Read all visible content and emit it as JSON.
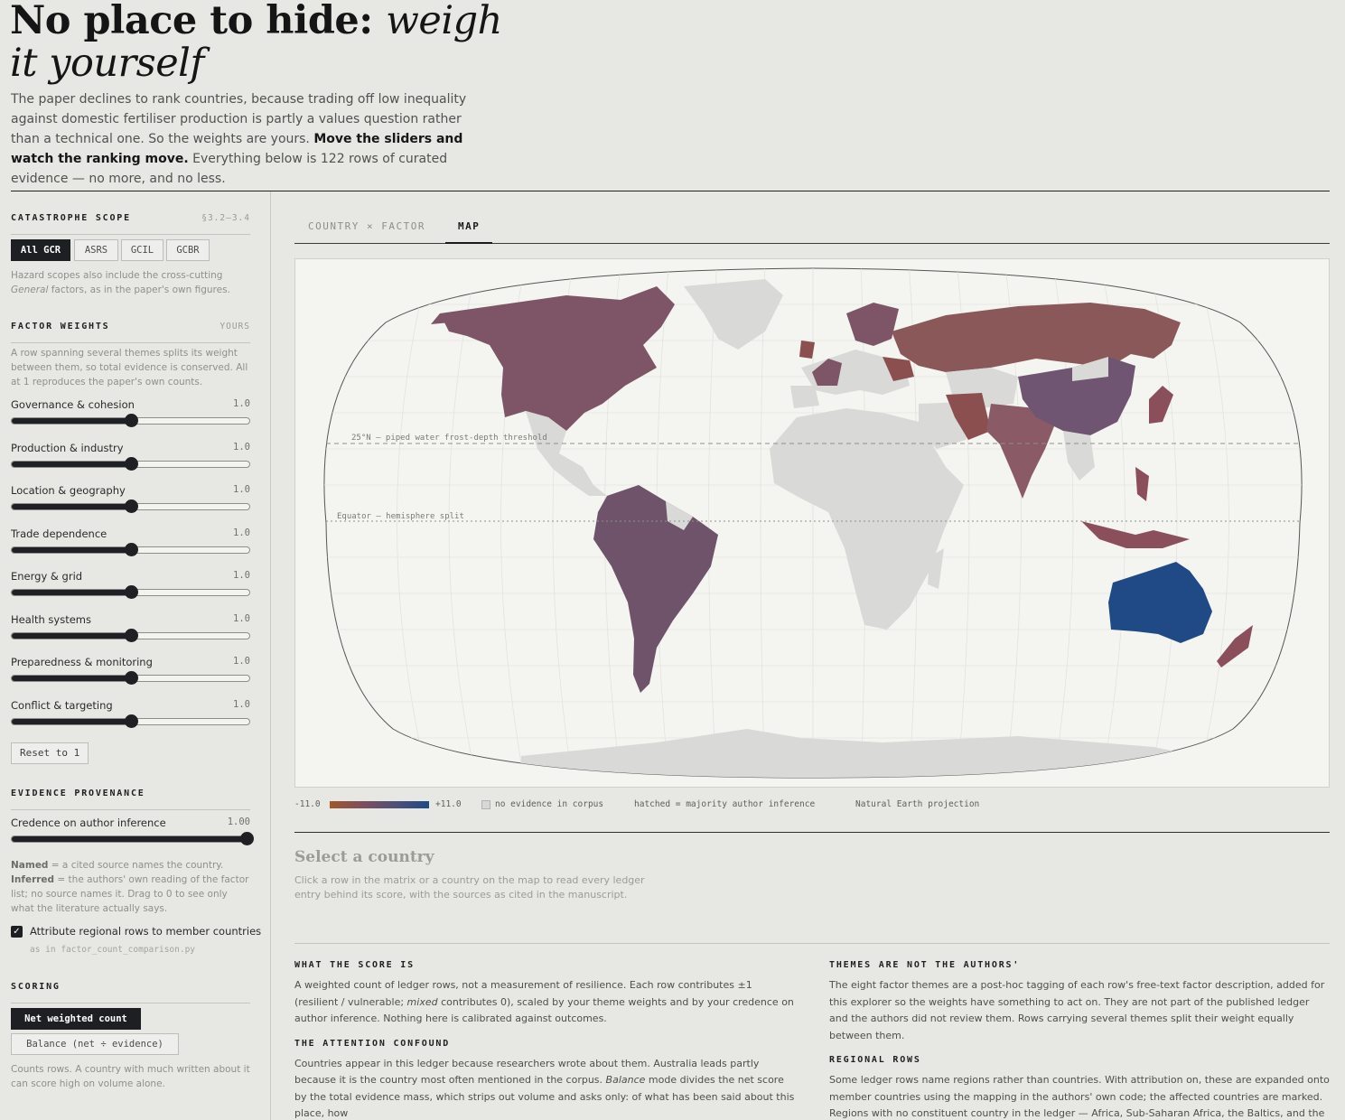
{
  "header": {
    "title_bold": "No place to hide:",
    "title_italic": "weigh it yourself",
    "intro_1": "The paper declines to rank countries, because trading off low inequality against domestic fertiliser production is partly a values question rather than a technical one. So the weights are yours.",
    "intro_bold": "Move the sliders and watch the ranking move.",
    "intro_2": "Everything below is 122 rows of curated evidence — no more, and no less."
  },
  "scope": {
    "label": "CATASTROPHE SCOPE",
    "ref": "§3.2–3.4",
    "options": [
      "All GCR",
      "ASRS",
      "GCIL",
      "GCBR"
    ],
    "selected": "All GCR",
    "note_1": "Hazard scopes also include the cross-cutting",
    "note_italic": "General",
    "note_2": "factors, as in the paper's own figures."
  },
  "weights": {
    "label": "FACTOR WEIGHTS",
    "ref": "YOURS",
    "note": "A row spanning several themes splits its weight between them, so total evidence is conserved. All at 1 reproduces the paper's own counts.",
    "slider_max": 2,
    "items": [
      {
        "name": "Governance & cohesion",
        "value": 1.0,
        "display": "1.0"
      },
      {
        "name": "Production & industry",
        "value": 1.0,
        "display": "1.0"
      },
      {
        "name": "Location & geography",
        "value": 1.0,
        "display": "1.0"
      },
      {
        "name": "Trade dependence",
        "value": 1.0,
        "display": "1.0"
      },
      {
        "name": "Energy & grid",
        "value": 1.0,
        "display": "1.0"
      },
      {
        "name": "Health systems",
        "value": 1.0,
        "display": "1.0"
      },
      {
        "name": "Preparedness & monitoring",
        "value": 1.0,
        "display": "1.0"
      },
      {
        "name": "Conflict & targeting",
        "value": 1.0,
        "display": "1.0"
      }
    ],
    "reset_label": "Reset to 1"
  },
  "provenance": {
    "label": "EVIDENCE PROVENANCE",
    "credence_label": "Credence on author inference",
    "credence_value": 1.0,
    "credence_display": "1.00",
    "named_term": "Named",
    "named_text": "= a cited source names the country.",
    "inferred_term": "Inferred",
    "inferred_text": "= the authors' own reading of the factor list; no source names it. Drag to 0 to see only what the literature actually says.",
    "attribute_label": "Attribute regional rows to member countries",
    "attribute_checked": true,
    "attribute_sub": "as in factor_count_comparison.py"
  },
  "scoring": {
    "label": "SCORING",
    "option_1": "Net weighted count",
    "option_2": "Balance (net ÷ evidence)",
    "selected": "Net weighted count",
    "note": "Counts rows. A country with much written about it can score high on volume alone."
  },
  "tabs": [
    "COUNTRY × FACTOR",
    "MAP"
  ],
  "active_tab": "MAP",
  "map": {
    "label_25n": "25°N — piped water frost-depth threshold",
    "label_equator": "Equator — hemisphere split",
    "colors": {
      "no_evidence": "#d9dad7",
      "negative": "#a0582a",
      "positive": "#1f4a86",
      "mid": "#6d4f68"
    }
  },
  "legend": {
    "min": "-11.0",
    "max": "+11.0",
    "no_evidence": "no evidence in corpus",
    "hatched": "hatched = majority author inference",
    "projection": "Natural Earth projection"
  },
  "detail": {
    "title": "Select a country",
    "desc": "Click a row in the matrix or a country on the map to read every ledger entry behind its score, with the sources as cited in the manuscript."
  },
  "notes": {
    "what_title": "WHAT THE SCORE IS",
    "what_text_1": "A weighted count of ledger rows, not a measurement of resilience. Each row contributes ±1 (resilient / vulnerable;",
    "what_italic": "mixed",
    "what_text_2": "contributes 0), scaled by your theme weights and by your credence on author inference. Nothing here is calibrated against outcomes.",
    "attention_title": "THE ATTENTION CONFOUND",
    "attention_text_1": "Countries appear in this ledger because researchers wrote about them. Australia leads partly because it is the country most often mentioned in the corpus.",
    "attention_italic": "Balance",
    "attention_text_2": "mode divides the net score by the total evidence mass, which strips out volume and asks only: of what has been said about this place, how",
    "themes_title": "THEMES ARE NOT THE AUTHORS'",
    "themes_text": "The eight factor themes are a post-hoc tagging of each row's free-text factor description, added for this explorer so the weights have something to act on. They are not part of the published ledger and the authors did not review them. Rows carrying several themes split their weight equally between them.",
    "regional_title": "REGIONAL ROWS",
    "regional_text": "Some ledger rows name regions rather than countries. With attribution on, these are expanded onto member countries using the mapping in the authors' own code; the affected countries are marked. Regions with no constituent country in the ledger — Africa, Sub-Saharan Africa, the Baltics, and the two"
  }
}
